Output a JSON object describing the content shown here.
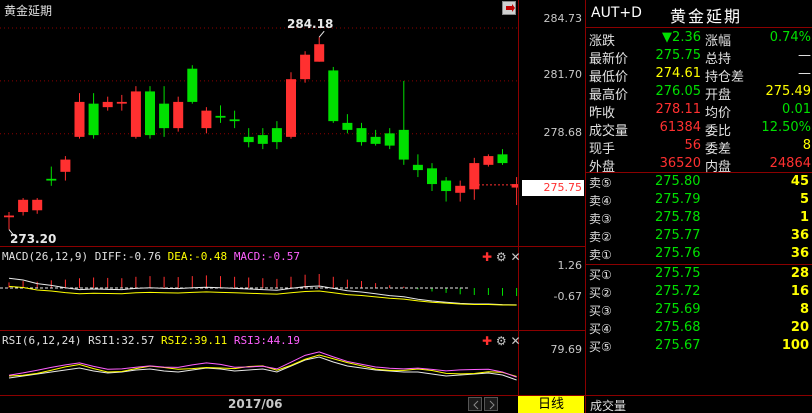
{
  "chart_header": {
    "title": "黄金延期"
  },
  "price_axis": {
    "ticks": [
      "284.73",
      "281.70",
      "278.68"
    ],
    "current": "275.75"
  },
  "macd_pane": {
    "label": "MACD(26,12,9)",
    "diff": "DIFF:-0.76",
    "dea": "DEA:-0.48",
    "macd": "MACD:-0.57",
    "axis_ticks": [
      "1.26",
      "-0.67"
    ]
  },
  "rsi_pane": {
    "label": "RSI(6,12,24)",
    "rsi1": "RSI1:32.57",
    "rsi2": "RSI2:39.11",
    "rsi3": "RSI3:44.19",
    "axis_ticks": [
      "79.69"
    ]
  },
  "x_axis": {
    "date_label": "2017/06"
  },
  "bottom_bar": {
    "period_tab": "日线",
    "volume_tab": "成交量"
  },
  "colors": {
    "up": "#ff3030",
    "down": "#00e000",
    "frame": "#8b0000",
    "price_badge": "#ff3030"
  },
  "chart_data": {
    "type": "candlestick",
    "high_annotation": "284.18",
    "low_annotation": "273.20",
    "ylim": [
      272.6,
      285.3
    ],
    "candles": [
      {
        "o": 273.9,
        "h": 274.2,
        "c": 274.0,
        "l": 273.2
      },
      {
        "o": 274.2,
        "h": 275.0,
        "c": 274.9,
        "l": 274.0
      },
      {
        "o": 274.3,
        "h": 275.0,
        "c": 274.9,
        "l": 274.1
      },
      {
        "o": 276.1,
        "h": 276.8,
        "c": 276.0,
        "l": 275.7
      },
      {
        "o": 276.5,
        "h": 277.4,
        "c": 277.2,
        "l": 276.0
      },
      {
        "o": 278.5,
        "h": 281.0,
        "c": 280.5,
        "l": 278.4
      },
      {
        "o": 280.4,
        "h": 281.0,
        "c": 278.6,
        "l": 278.4
      },
      {
        "o": 280.2,
        "h": 280.8,
        "c": 280.5,
        "l": 280.0
      },
      {
        "o": 280.4,
        "h": 280.9,
        "c": 280.5,
        "l": 280.0
      },
      {
        "o": 278.5,
        "h": 281.4,
        "c": 281.1,
        "l": 278.4
      },
      {
        "o": 281.1,
        "h": 281.4,
        "c": 278.6,
        "l": 278.4
      },
      {
        "o": 280.4,
        "h": 281.4,
        "c": 279.0,
        "l": 278.5
      },
      {
        "o": 279.0,
        "h": 280.8,
        "c": 280.5,
        "l": 278.8
      },
      {
        "o": 282.4,
        "h": 282.6,
        "c": 280.5,
        "l": 280.4
      },
      {
        "o": 279.0,
        "h": 280.2,
        "c": 280.0,
        "l": 278.7
      },
      {
        "o": 279.7,
        "h": 280.3,
        "c": 279.6,
        "l": 279.3
      },
      {
        "o": 279.5,
        "h": 280.0,
        "c": 279.4,
        "l": 279.0
      },
      {
        "o": 278.5,
        "h": 279.0,
        "c": 278.2,
        "l": 277.9
      },
      {
        "o": 278.6,
        "h": 279.0,
        "c": 278.1,
        "l": 277.8
      },
      {
        "o": 279.0,
        "h": 279.4,
        "c": 278.2,
        "l": 277.8
      },
      {
        "o": 278.5,
        "h": 282.2,
        "c": 281.8,
        "l": 278.4
      },
      {
        "o": 281.8,
        "h": 283.4,
        "c": 283.2,
        "l": 281.6
      },
      {
        "o": 282.8,
        "h": 284.2,
        "c": 283.8,
        "l": 282.8
      },
      {
        "o": 282.3,
        "h": 282.5,
        "c": 279.4,
        "l": 279.3
      },
      {
        "o": 279.3,
        "h": 279.8,
        "c": 278.9,
        "l": 278.7
      },
      {
        "o": 279.0,
        "h": 279.3,
        "c": 278.2,
        "l": 278.0
      },
      {
        "o": 278.5,
        "h": 278.9,
        "c": 278.1,
        "l": 278.0
      },
      {
        "o": 278.7,
        "h": 279.0,
        "c": 278.0,
        "l": 277.8
      },
      {
        "o": 278.9,
        "h": 281.7,
        "c": 277.2,
        "l": 276.9
      },
      {
        "o": 276.9,
        "h": 277.5,
        "c": 276.6,
        "l": 276.2
      },
      {
        "o": 276.7,
        "h": 277.0,
        "c": 275.8,
        "l": 275.4
      },
      {
        "o": 276.0,
        "h": 276.2,
        "c": 275.4,
        "l": 274.8
      },
      {
        "o": 275.3,
        "h": 276.0,
        "c": 275.7,
        "l": 274.8
      },
      {
        "o": 275.5,
        "h": 277.3,
        "c": 277.0,
        "l": 274.9
      },
      {
        "o": 276.9,
        "h": 277.5,
        "c": 277.4,
        "l": 276.8
      },
      {
        "o": 277.5,
        "h": 277.8,
        "c": 277.0,
        "l": 276.9
      },
      {
        "o": 275.6,
        "h": 276.2,
        "c": 275.8,
        "l": 274.6
      }
    ]
  },
  "quote": {
    "symbol": "AUT+D",
    "name": "黄金延期",
    "rows": [
      {
        "l1": "涨跌",
        "v1": "▼2.36",
        "c1": "green",
        "l2": "涨幅",
        "v2": "0.74%",
        "c2": "green"
      },
      {
        "l1": "最新价",
        "v1": "275.75",
        "c1": "green",
        "l2": "总持",
        "v2": "—",
        "c2": "white"
      },
      {
        "l1": "最低价",
        "v1": "274.61",
        "c1": "yellow",
        "l2": "持仓差",
        "v2": "—",
        "c2": "white"
      },
      {
        "l1": "最高价",
        "v1": "276.05",
        "c1": "green",
        "l2": "开盘",
        "v2": "275.49",
        "c2": "yellow"
      },
      {
        "l1": "昨收",
        "v1": "278.11",
        "c1": "red",
        "l2": "均价",
        "v2": "0.01",
        "c2": "green"
      },
      {
        "l1": "成交量",
        "v1": "61384",
        "c1": "red",
        "l2": "委比",
        "v2": "12.50%",
        "c2": "green"
      },
      {
        "l1": "现手",
        "v1": "56",
        "c1": "red",
        "l2": "委差",
        "v2": "8",
        "c2": "yellow"
      },
      {
        "l1": "外盘",
        "v1": "36520",
        "c1": "red",
        "l2": "内盘",
        "v2": "24864",
        "c2": "red"
      }
    ],
    "asks": [
      {
        "label": "卖⑤",
        "price": "275.80",
        "vol": "45"
      },
      {
        "label": "卖④",
        "price": "275.79",
        "vol": "5"
      },
      {
        "label": "卖③",
        "price": "275.78",
        "vol": "1"
      },
      {
        "label": "卖②",
        "price": "275.77",
        "vol": "36"
      },
      {
        "label": "卖①",
        "price": "275.76",
        "vol": "36"
      }
    ],
    "bids": [
      {
        "label": "买①",
        "price": "275.75",
        "vol": "28"
      },
      {
        "label": "买②",
        "price": "275.72",
        "vol": "16"
      },
      {
        "label": "买③",
        "price": "275.69",
        "vol": "8"
      },
      {
        "label": "买④",
        "price": "275.68",
        "vol": "20"
      },
      {
        "label": "买⑤",
        "price": "275.67",
        "vol": "100"
      }
    ]
  }
}
